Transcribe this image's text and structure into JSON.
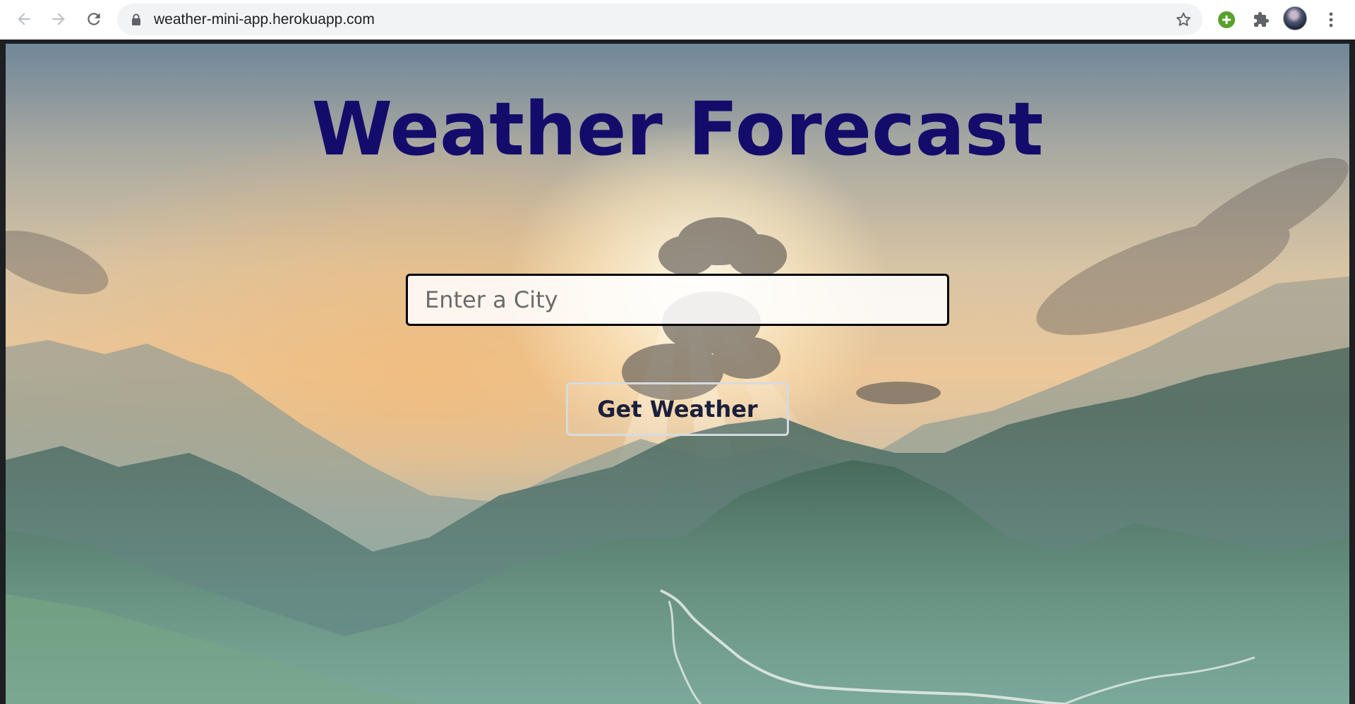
{
  "browser": {
    "url": "weather-mini-app.herokuapp.com",
    "icons": [
      "back-arrow-icon",
      "forward-arrow-icon",
      "reload-icon",
      "lock-icon",
      "star-icon",
      "plus-extension-icon",
      "puzzle-extensions-icon",
      "profile-avatar",
      "kebab-menu-icon"
    ]
  },
  "page": {
    "title": "Weather Forecast",
    "city_input": {
      "placeholder": "Enter a City",
      "value": ""
    },
    "submit_label": "Get Weather",
    "colors": {
      "title": "#140c6b",
      "button_text": "#1b1f3b",
      "input_border": "#000000"
    }
  }
}
